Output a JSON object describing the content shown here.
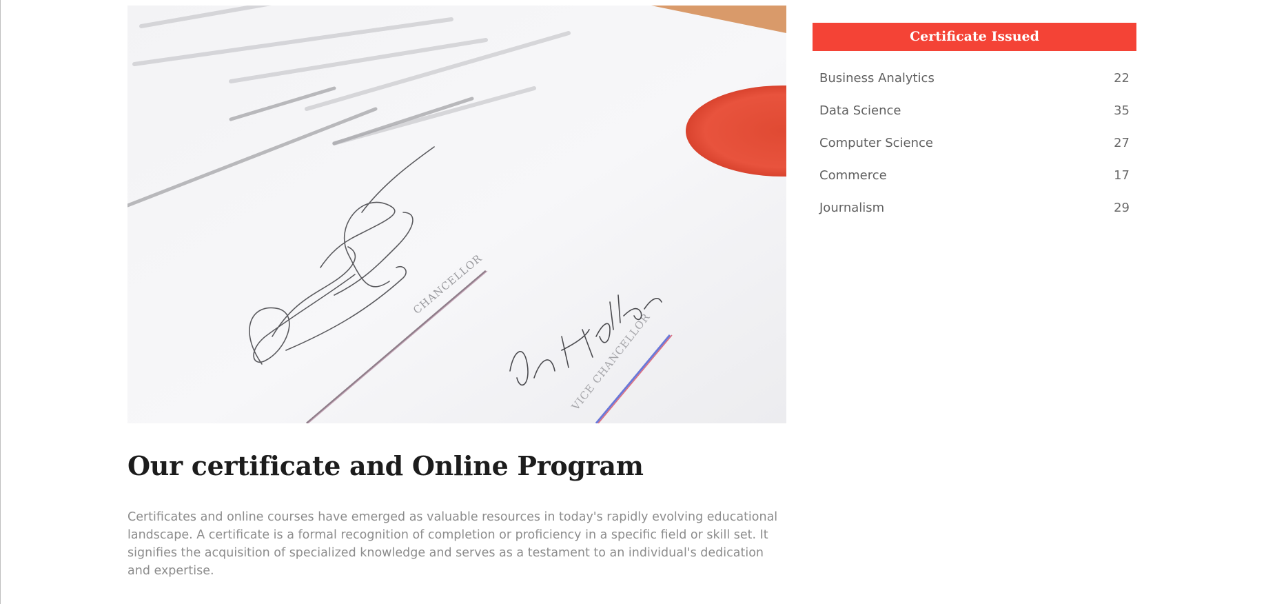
{
  "hero": {
    "image_alt": "certificate",
    "signature_labels": [
      "CHANCELLOR",
      "VICE CHANCELLOR"
    ],
    "seal_color": "#e8523e"
  },
  "article": {
    "title": "Our certificate and Online Program",
    "body": "Certificates and online courses have emerged as valuable resources in today's rapidly evolving educational landscape. A certificate is a formal recognition of completion or proficiency in a specific field or skill set. It signifies the acquisition of specialized knowledge and serves as a testament to an individual's dedication and expertise."
  },
  "sidebar": {
    "widget_title": "Certificate Issued",
    "accent_color": "#f44336",
    "categories": [
      {
        "label": "Business Analytics",
        "count": "22"
      },
      {
        "label": "Data Science",
        "count": "35"
      },
      {
        "label": "Computer Science",
        "count": "27"
      },
      {
        "label": "Commerce",
        "count": "17"
      },
      {
        "label": "Journalism",
        "count": "29"
      }
    ]
  }
}
